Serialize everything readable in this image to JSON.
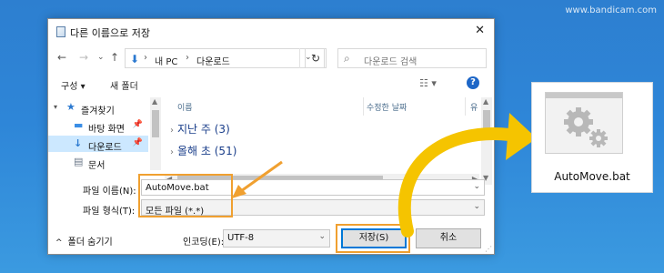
{
  "watermark": "www.bandicam.com",
  "dialog": {
    "title": "다른 이름으로 저장",
    "close": "✕",
    "address": {
      "crumbs": [
        "내 PC",
        "다운로드"
      ],
      "search_placeholder": "다운로드 검색"
    },
    "toolbar": {
      "organize": "구성 ▾",
      "new_folder": "새 폴더",
      "help": "?"
    },
    "nav": {
      "items": [
        {
          "icon": "★",
          "label": "즐겨찾기"
        },
        {
          "icon": "▬",
          "label": "바탕 화면"
        },
        {
          "icon": "↓",
          "label": "다운로드"
        },
        {
          "icon": "▤",
          "label": "문서"
        }
      ]
    },
    "columns": {
      "name": "이름",
      "modified": "수정한 날짜",
      "type": "유"
    },
    "groups": [
      {
        "label": "지난 주 (3)"
      },
      {
        "label": "올해 초 (51)"
      }
    ],
    "filename": {
      "label": "파일 이름(N):",
      "value": "AutoMove.bat"
    },
    "filetype": {
      "label": "파일 형식(T):",
      "value": "모든 파일 (*.*)"
    },
    "hide_folders": "폴더 숨기기",
    "encoding": {
      "label": "인코딩(E):",
      "value": "UTF-8"
    },
    "save_button": "저장(S)",
    "cancel_button": "취소"
  },
  "file_icon": {
    "name": "AutoMove.bat"
  },
  "colors": {
    "highlight": "#f0a030",
    "arrow_yellow": "#f5c400",
    "background": "#2e86d8"
  }
}
